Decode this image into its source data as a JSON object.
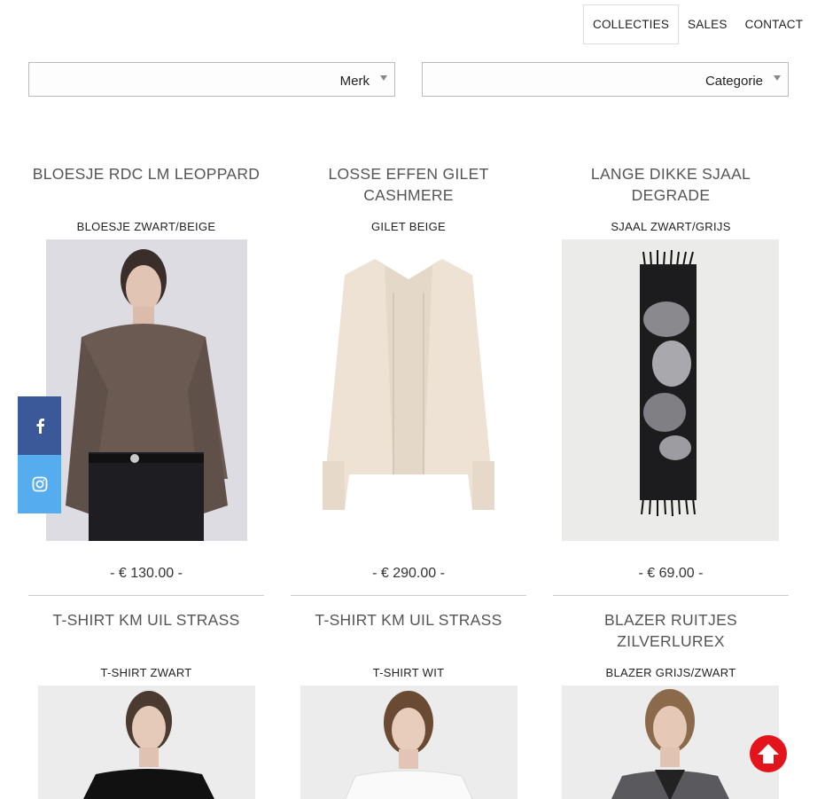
{
  "nav": {
    "items": [
      {
        "label": "COLLECTIES",
        "active": true
      },
      {
        "label": "SALES",
        "active": false
      },
      {
        "label": "CONTACT",
        "active": false
      }
    ]
  },
  "filters": {
    "merk": "Merk",
    "categorie": "Categorie"
  },
  "products": [
    {
      "title": "BLOESJE RDC LM LEOPPARD",
      "variant": "BLOESJE ZWART/BEIGE",
      "price": "-  € 130.00 -"
    },
    {
      "title": "LOSSE EFFEN GILET CASHMERE",
      "variant": "GILET BEIGE",
      "price": "-  € 290.00 -"
    },
    {
      "title": "LANGE DIKKE SJAAL DEGRADE",
      "variant": "SJAAL ZWART/GRIJS",
      "price": "-  € 69.00 -"
    },
    {
      "title": "T-SHIRT KM UIL STRASS",
      "variant": "T-SHIRT ZWART",
      "price": ""
    },
    {
      "title": "T-SHIRT KM UIL STRASS",
      "variant": "T-SHIRT WIT",
      "price": ""
    },
    {
      "title": "BLAZER RUITJES ZILVERLUREX",
      "variant": "BLAZER GRIJS/ZWART",
      "price": ""
    }
  ],
  "social": {
    "facebook_icon": "facebook-icon",
    "instagram_icon": "instagram-icon",
    "facebook_color": "#3b5998",
    "instagram_color": "#55acee"
  },
  "scroll_top": {
    "icon": "arrow-up-icon",
    "color": "#e4141c"
  }
}
